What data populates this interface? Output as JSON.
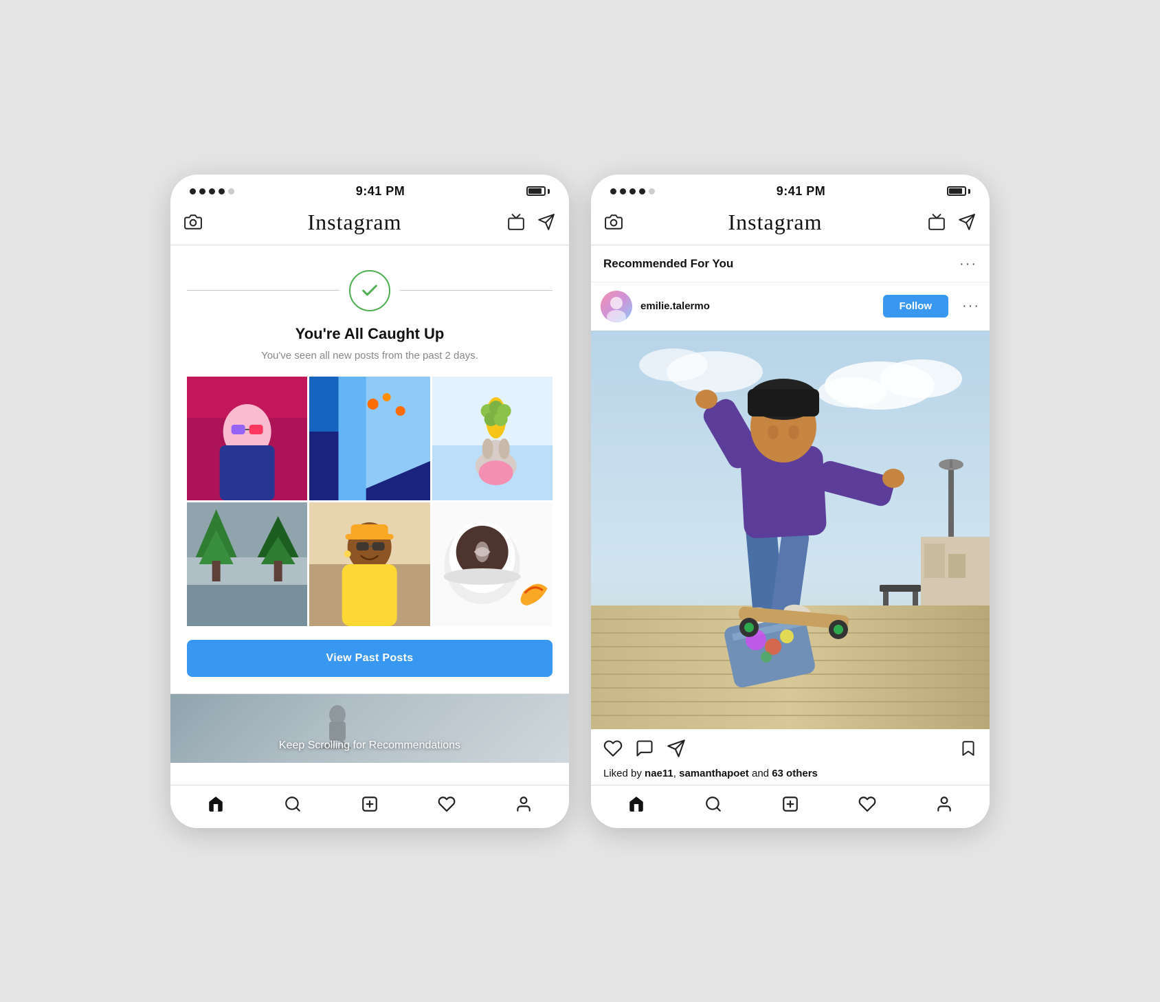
{
  "left_phone": {
    "status_bar": {
      "time": "9:41 PM"
    },
    "header": {
      "logo": "Instagram",
      "camera_icon": "camera",
      "tv_icon": "tv",
      "send_icon": "send"
    },
    "caught_up": {
      "title": "You're All Caught Up",
      "subtitle": "You've seen all new posts from the past 2 days.",
      "view_past_label": "View Past Posts"
    },
    "banner": {
      "text": "Keep Scrolling for Recommendations"
    },
    "bottom_nav": {
      "items": [
        "home",
        "search",
        "add",
        "heart",
        "profile"
      ]
    }
  },
  "right_phone": {
    "status_bar": {
      "time": "9:41 PM"
    },
    "header": {
      "logo": "Instagram",
      "camera_icon": "camera",
      "tv_icon": "tv",
      "send_icon": "send"
    },
    "recommended": {
      "title": "Recommended For You",
      "more_options": "···"
    },
    "post": {
      "username": "emilie.talermo",
      "follow_label": "Follow",
      "more_options": "···",
      "likes_text_prefix": "Liked by ",
      "likes_bold1": "nae11",
      "likes_separator": ", ",
      "likes_bold2": "samanthapoet",
      "likes_suffix": " and ",
      "likes_bold3": "63 others"
    },
    "bottom_nav": {
      "items": [
        "home",
        "search",
        "add",
        "heart",
        "profile"
      ]
    }
  }
}
